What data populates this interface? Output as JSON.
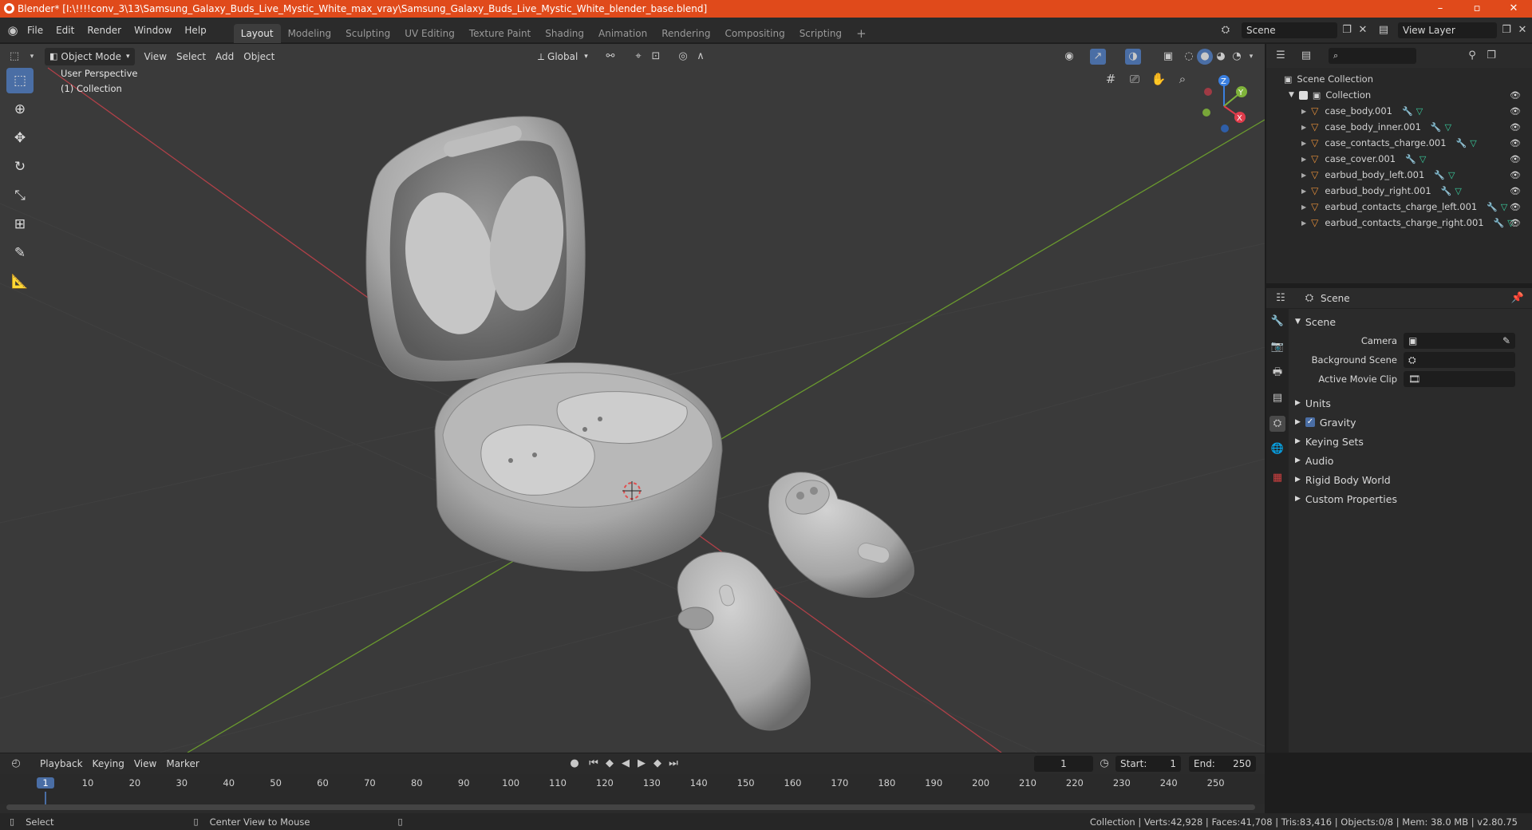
{
  "window": {
    "title": "Blender* [I:\\!!!!conv_3\\13\\Samsung_Galaxy_Buds_Live_Mystic_White_max_vray\\Samsung_Galaxy_Buds_Live_Mystic_White_blender_base.blend]",
    "minimize": "–",
    "maximize": "▫",
    "close": "✕"
  },
  "menu": {
    "items": [
      "File",
      "Edit",
      "Render",
      "Window",
      "Help"
    ]
  },
  "workspaces": [
    "Layout",
    "Modeling",
    "Sculpting",
    "UV Editing",
    "Texture Paint",
    "Shading",
    "Animation",
    "Rendering",
    "Compositing",
    "Scripting"
  ],
  "active_workspace": "Layout",
  "scene_field": "Scene",
  "view_layer_field": "View Layer",
  "viewport": {
    "mode": "Object Mode",
    "header_menus": [
      "View",
      "Select",
      "Add",
      "Object"
    ],
    "transform_orientation": "Global",
    "overlay_title": "User Perspective",
    "overlay_collection": "(1) Collection",
    "gizmo_axes": {
      "x": "X",
      "y": "Y",
      "z": "Z"
    }
  },
  "outliner": {
    "root": "Scene Collection",
    "collection": "Collection",
    "objects": [
      "case_body.001",
      "case_body_inner.001",
      "case_contacts_charge.001",
      "case_cover.001",
      "earbud_body_left.001",
      "earbud_body_right.001",
      "earbud_contacts_charge_left.001",
      "earbud_contacts_charge_right.001"
    ]
  },
  "properties": {
    "header": "Scene",
    "panel": "Scene",
    "camera_label": "Camera",
    "background_scene_label": "Background Scene",
    "active_movie_clip_label": "Active Movie Clip",
    "subpanels": [
      "Units",
      "Gravity",
      "Keying Sets",
      "Audio",
      "Rigid Body World",
      "Custom Properties"
    ],
    "gravity_checked": true
  },
  "timeline": {
    "menus": [
      "Playback",
      "Keying",
      "View",
      "Marker"
    ],
    "current_frame": "1",
    "start_label": "Start:",
    "start_value": "1",
    "end_label": "End:",
    "end_value": "250",
    "ruler": [
      "1",
      "10",
      "20",
      "30",
      "40",
      "50",
      "60",
      "70",
      "80",
      "90",
      "100",
      "110",
      "120",
      "130",
      "140",
      "150",
      "160",
      "170",
      "180",
      "190",
      "200",
      "210",
      "220",
      "230",
      "240",
      "250"
    ]
  },
  "status": {
    "left_action": "Select",
    "middle_action": "Center View to Mouse",
    "stats": "Collection | Verts:42,928 | Faces:41,708 | Tris:83,416 | Objects:0/8 | Mem: 38.0 MB | v2.80.75"
  },
  "colors": {
    "title_bar": "#e04a1b",
    "accent_blue": "#4a6ea5",
    "x_axis": "#e03c4b",
    "y_axis": "#7fb33a",
    "z_axis": "#3a7fe0"
  }
}
